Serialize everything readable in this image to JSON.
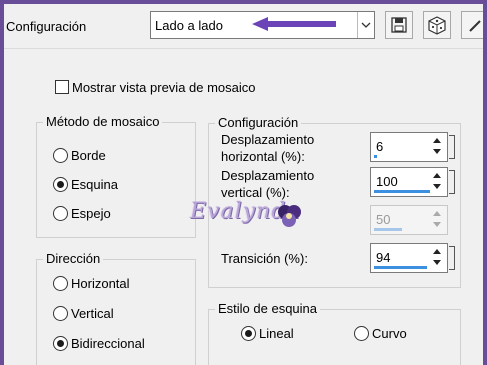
{
  "toolbar": {
    "preset_label": "Configuración",
    "preset_value": "Lado a lado"
  },
  "preview": {
    "mosaic_preview_label": "Mostrar vista previa de mosaico",
    "checked": false
  },
  "mosaic_method": {
    "title": "Método de mosaico",
    "options": [
      {
        "label": "Borde",
        "selected": false
      },
      {
        "label": "Esquina",
        "selected": true
      },
      {
        "label": "Espejo",
        "selected": false
      }
    ]
  },
  "direction": {
    "title": "Dirección",
    "options": [
      {
        "label": "Horizontal",
        "selected": false
      },
      {
        "label": "Vertical",
        "selected": false
      },
      {
        "label": "Bidireccional",
        "selected": true
      }
    ]
  },
  "settings": {
    "title": "Configuración",
    "horizontal_offset": {
      "label_line1": "Desplazamiento",
      "label_line2": "horizontal (%):",
      "value": "6",
      "fill": 0.06
    },
    "vertical_offset": {
      "label_line1": "Desplazamiento",
      "label_line2": "vertical (%):",
      "value": "100",
      "fill": 1.0
    },
    "disabled_value": {
      "value": "50",
      "fill": 0.5
    },
    "transition": {
      "label": "Transición (%):",
      "value": "94",
      "fill": 0.94
    }
  },
  "corner_style": {
    "title": "Estilo de esquina",
    "options": [
      {
        "label": "Lineal",
        "selected": true
      },
      {
        "label": "Curvo",
        "selected": false
      }
    ]
  },
  "watermark_text": "Evalynda",
  "colors": {
    "border": "#6a4d98",
    "arrow": "#6b45b8",
    "spin_bar": "#3d8fe0"
  }
}
